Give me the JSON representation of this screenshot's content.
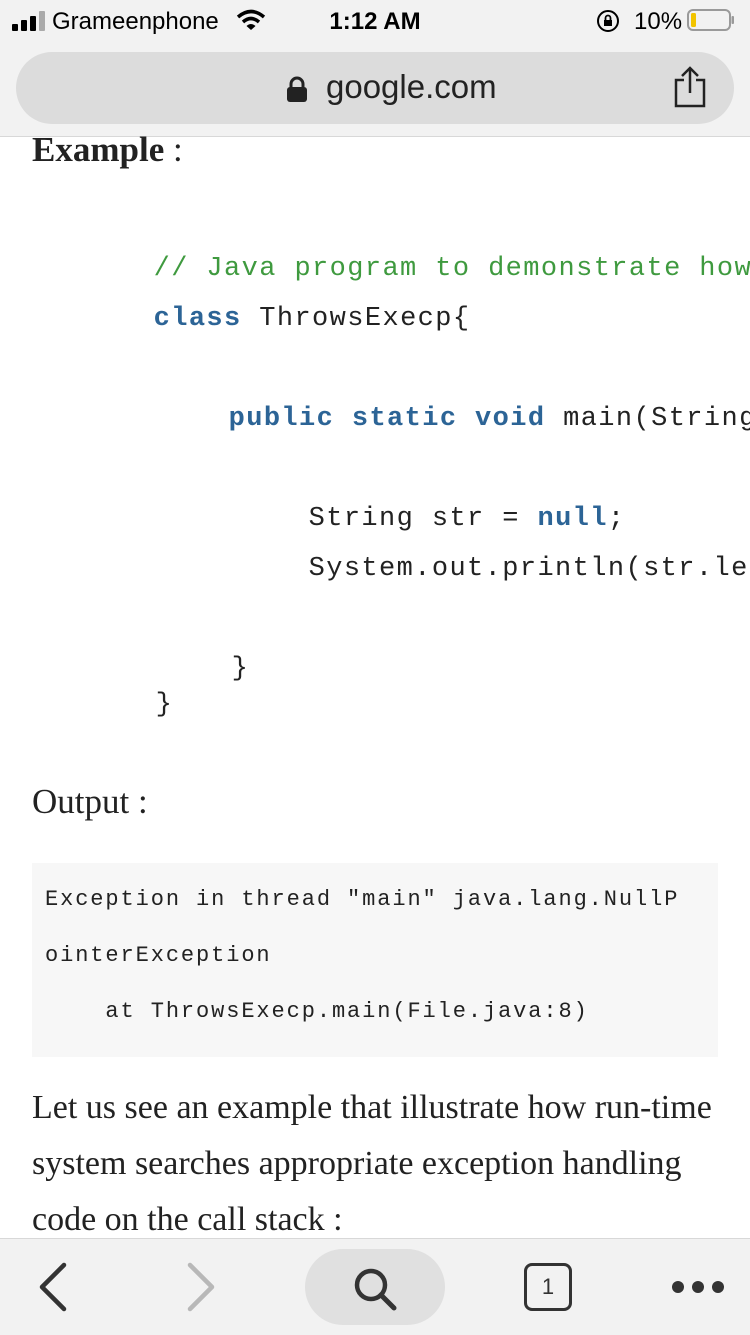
{
  "status_bar": {
    "carrier": "Grameenphone",
    "time": "1:12 AM",
    "battery": "10%"
  },
  "browser": {
    "url": "google.com"
  },
  "article": {
    "example_heading": "Example",
    "example_colon": " :",
    "code_lines": {
      "comment": "// Java program to demonstrate how",
      "class_kw": "class",
      "class_name": " ThrowsExecp{",
      "method_kw": "public static void",
      "method_rest": " main(String",
      "str_decl": "String str = ",
      "null_kw": "null",
      "semicolon": ";",
      "println": "System.out.println(str.leng",
      "close_method": "}",
      "close_class": "}"
    },
    "output_heading": "Output :",
    "output_lines": [
      "Exception in thread \"main\" java.lang.NullP",
      "ointerException",
      "    at ThrowsExecp.main(File.java:8)"
    ],
    "paragraph": "Let us see an example that illustrate how run-time system searches appropriate exception handling code on the call stack :"
  },
  "toolbar": {
    "tab_count": "1"
  },
  "colors": {
    "keyword": "#2c6496",
    "comment": "#3f9a3f",
    "bar_bg": "#f2f2f2"
  }
}
